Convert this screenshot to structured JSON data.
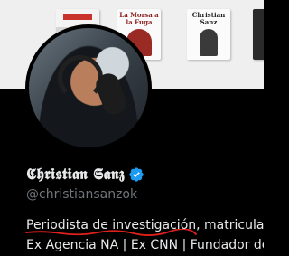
{
  "banner": {
    "books": [
      {
        "title": ""
      },
      {
        "title": "La Morsa a la Fuga"
      },
      {
        "title": "Christian Sanz"
      },
      {
        "title": ""
      }
    ]
  },
  "profile": {
    "display_name": "𝕮𝖍𝖗𝖎𝖘𝖙𝖎𝖆𝖓 𝕾𝖆𝖓𝖟",
    "handle": "@christiansanzok",
    "bio_line1_highlight": "Periodista de investigación",
    "bio_line1_rest": ", matriculad",
    "bio_line2": "Ex Agencia NA | Ex CNN | Fundador de"
  },
  "colors": {
    "verified_badge": "#1d9bf0",
    "underline_annotation": "#e0201b",
    "background": "#000000"
  },
  "icons": {
    "verified": "verified-badge-icon"
  }
}
